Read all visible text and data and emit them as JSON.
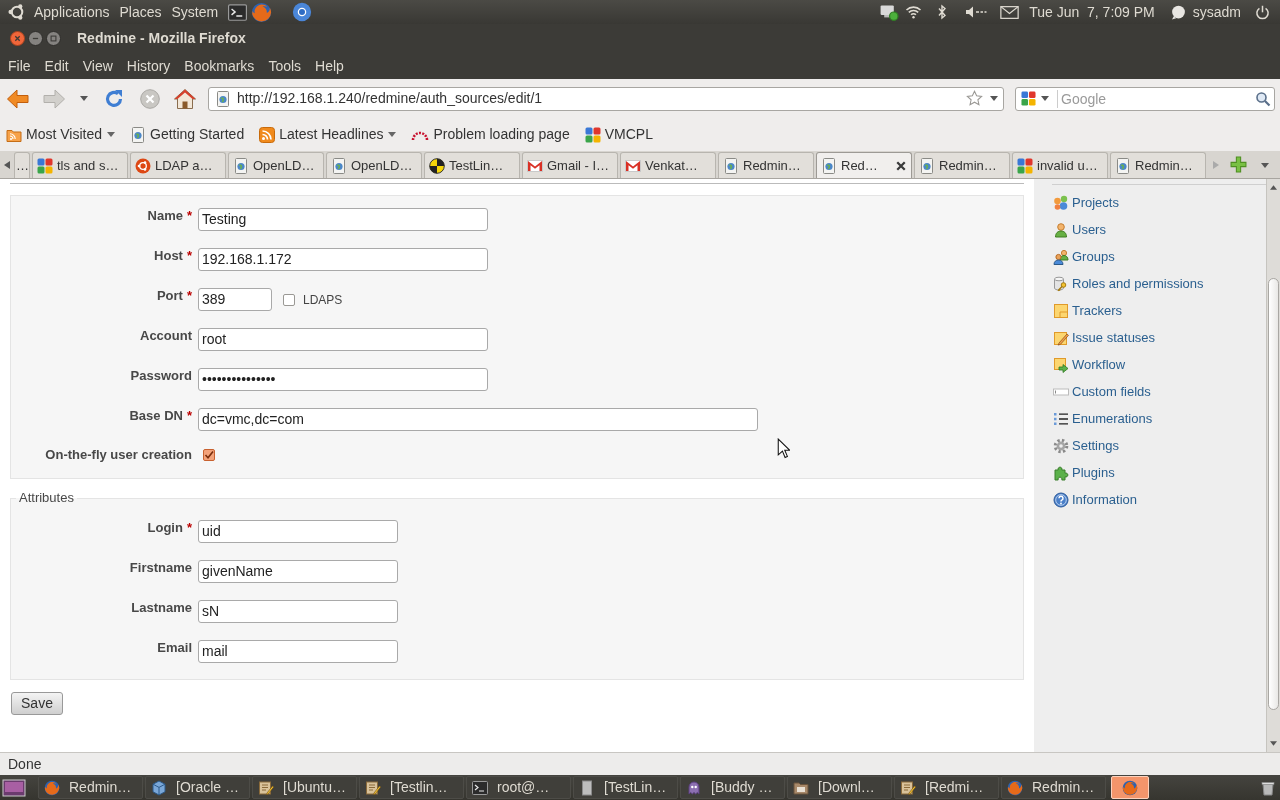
{
  "top_panel": {
    "menus": [
      "Applications",
      "Places",
      "System"
    ],
    "clock": "Tue Jun  7, 7:09 PM",
    "user": "sysadm"
  },
  "window": {
    "title": "Redmine - Mozilla Firefox"
  },
  "menu_bar": [
    "File",
    "Edit",
    "View",
    "History",
    "Bookmarks",
    "Tools",
    "Help"
  ],
  "navigation": {
    "url": "http://192.168.1.240/redmine/auth_sources/edit/1",
    "search": {
      "placeholder": "Google"
    }
  },
  "bookmarks": [
    {
      "label": "Most Visited",
      "kind": "folder",
      "menu": true
    },
    {
      "label": "Getting Started",
      "kind": "page",
      "menu": false
    },
    {
      "label": "Latest Headlines",
      "kind": "feed",
      "menu": true
    },
    {
      "label": "Problem loading page",
      "kind": "error",
      "menu": false
    },
    {
      "label": "VMCPL",
      "kind": "squares",
      "menu": false
    }
  ],
  "tabs": [
    {
      "label": "…",
      "selected": false
    },
    {
      "label": "tls and s…",
      "kind": "squares",
      "selected": false
    },
    {
      "label": "LDAP a…",
      "kind": "logo",
      "selected": false
    },
    {
      "label": "OpenLD…",
      "kind": "page",
      "selected": false
    },
    {
      "label": "OpenLD…",
      "kind": "page",
      "selected": false
    },
    {
      "label": "TestLin…",
      "kind": "disc",
      "selected": false
    },
    {
      "label": "Gmail - I…",
      "kind": "mail",
      "selected": false
    },
    {
      "label": "Venkat…",
      "kind": "mail",
      "selected": false
    },
    {
      "label": "Redmin…",
      "kind": "page",
      "selected": false
    },
    {
      "label": "Red…",
      "kind": "page",
      "selected": true
    },
    {
      "label": "Redmin…",
      "kind": "page",
      "selected": false
    },
    {
      "label": "invalid u…",
      "kind": "squares",
      "selected": false
    },
    {
      "label": "Redmin…",
      "kind": "page",
      "selected": false
    }
  ],
  "connection": {
    "fields": [
      {
        "label": "Name",
        "required_mark": "*",
        "kind": "text",
        "value": "Testing"
      },
      {
        "label": "Host",
        "required_mark": "*",
        "kind": "text",
        "value": "192.168.1.172"
      },
      {
        "label": "Port",
        "required_mark": "*",
        "kind": "port",
        "value": "389",
        "option": {
          "label": "LDAPS",
          "checked": false
        }
      },
      {
        "label": "Account",
        "kind": "text",
        "value": "root"
      },
      {
        "label": "Password",
        "kind": "text",
        "value": "•••••••••••••••"
      },
      {
        "label": "Base DN",
        "required_mark": "*",
        "kind": "long",
        "value": "dc=vmc,dc=com"
      },
      {
        "label": "On-the-fly user creation",
        "kind": "checkbox",
        "checked": true
      }
    ]
  },
  "attributes": {
    "legend": "Attributes",
    "fields": [
      {
        "label": "Login",
        "required_mark": "*",
        "value": "uid"
      },
      {
        "label": "Firstname",
        "value": "givenName"
      },
      {
        "label": "Lastname",
        "value": "sN"
      },
      {
        "label": "Email",
        "value": "mail"
      }
    ]
  },
  "save_button": "Save",
  "sidebar": {
    "items": [
      {
        "label": "Projects",
        "kind": "projects"
      },
      {
        "label": "Users",
        "kind": "users"
      },
      {
        "label": "Groups",
        "kind": "groups"
      },
      {
        "label": "Roles and permissions",
        "kind": "roles"
      },
      {
        "label": "Trackers",
        "kind": "trackers"
      },
      {
        "label": "Issue statuses",
        "kind": "statuses"
      },
      {
        "label": "Workflow",
        "kind": "workflow"
      },
      {
        "label": "Custom fields",
        "kind": "fields"
      },
      {
        "label": "Enumerations",
        "kind": "enumerations"
      },
      {
        "label": "Settings",
        "kind": "settings"
      },
      {
        "label": "Plugins",
        "kind": "plugins"
      },
      {
        "label": "Information",
        "kind": "information"
      }
    ]
  },
  "status_bar": "Done",
  "taskbar": [
    {
      "label": "Redmin…",
      "kind": "browser",
      "attention": false
    },
    {
      "label": "[Oracle …",
      "kind": "cube",
      "attention": false
    },
    {
      "label": "[Ubuntu…",
      "kind": "editor",
      "attention": false
    },
    {
      "label": "[Testlin…",
      "kind": "editor",
      "attention": false
    },
    {
      "label": "root@…",
      "kind": "terminal",
      "attention": false
    },
    {
      "label": "[TestLin…",
      "kind": "document",
      "attention": false
    },
    {
      "label": "[Buddy …",
      "kind": "chat",
      "attention": false
    },
    {
      "label": "[Downl…",
      "kind": "folder",
      "attention": false
    },
    {
      "label": "[Redmi…",
      "kind": "editor",
      "attention": false
    },
    {
      "label": "Redmin…",
      "kind": "browser",
      "attention": false
    },
    {
      "kind": "browser",
      "attention": true
    }
  ]
}
